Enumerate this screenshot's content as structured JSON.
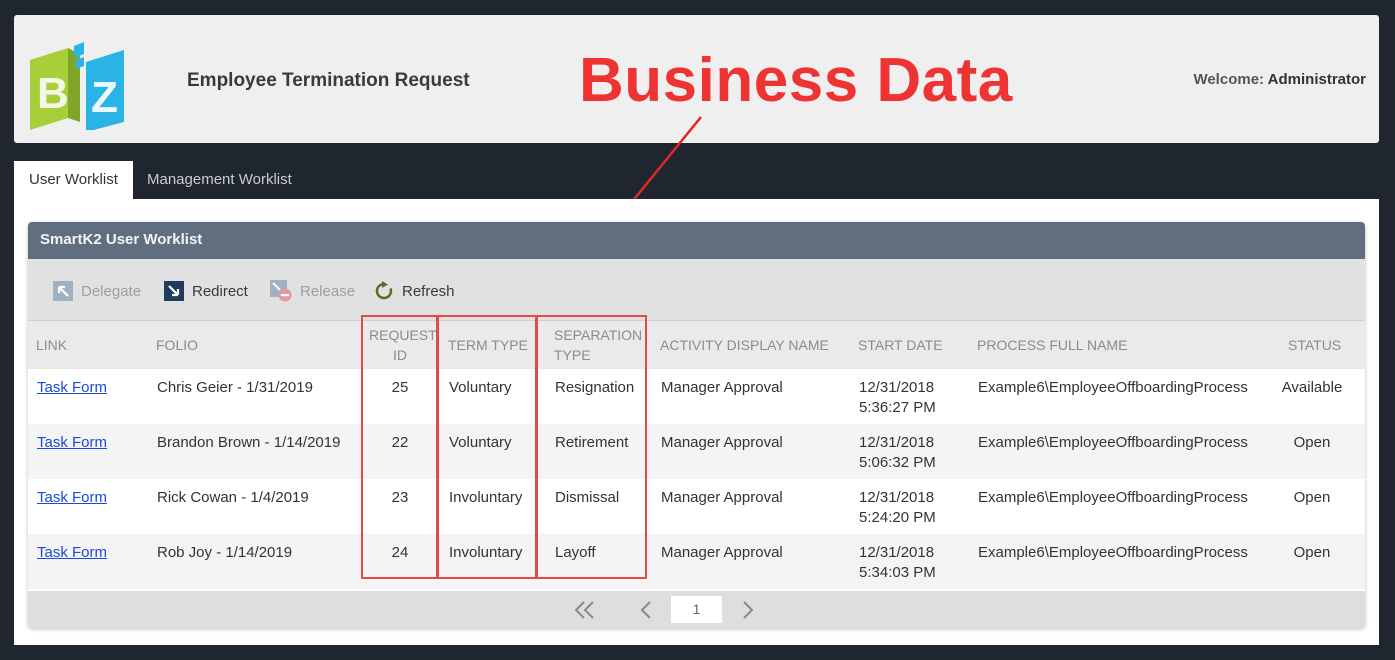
{
  "app": {
    "title": "Employee Termination Request",
    "welcome_label": "Welcome:",
    "user": "Administrator",
    "banner": "Business Data"
  },
  "tabs": [
    {
      "label": "User Worklist",
      "active": true
    },
    {
      "label": "Management Worklist",
      "active": false
    }
  ],
  "panel": {
    "title": "SmartK2 User Worklist"
  },
  "toolbar": {
    "delegate": "Delegate",
    "redirect": "Redirect",
    "release": "Release",
    "refresh": "Refresh"
  },
  "columns": {
    "link": "LINK",
    "folio": "FOLIO",
    "request_id_1": "REQUEST",
    "request_id_2": "ID",
    "term_type": "TERM TYPE",
    "separation_type_1": "SEPARATION",
    "separation_type_2": "TYPE",
    "activity": "ACTIVITY DISPLAY NAME",
    "start_date": "START DATE",
    "process": "PROCESS FULL NAME",
    "status": "STATUS"
  },
  "rows": [
    {
      "link": "Task Form",
      "folio": "Chris Geier - 1/31/2019",
      "request_id": "25",
      "term_type": "Voluntary",
      "separation_type": "Resignation",
      "activity": "Manager Approval",
      "date": "12/31/2018",
      "time": "5:36:27 PM",
      "process": "Example6\\EmployeeOffboardingProcess",
      "status": "Available"
    },
    {
      "link": "Task Form",
      "folio": "Brandon Brown - 1/14/2019",
      "request_id": "22",
      "term_type": "Voluntary",
      "separation_type": "Retirement",
      "activity": "Manager Approval",
      "date": "12/31/2018",
      "time": "5:06:32 PM",
      "process": "Example6\\EmployeeOffboardingProcess",
      "status": "Open"
    },
    {
      "link": "Task Form",
      "folio": "Rick Cowan - 1/4/2019",
      "request_id": "23",
      "term_type": "Involuntary",
      "separation_type": "Dismissal",
      "activity": "Manager Approval",
      "date": "12/31/2018",
      "time": "5:24:20 PM",
      "process": "Example6\\EmployeeOffboardingProcess",
      "status": "Open"
    },
    {
      "link": "Task Form",
      "folio": "Rob Joy - 1/14/2019",
      "request_id": "24",
      "term_type": "Involuntary",
      "separation_type": "Layoff",
      "activity": "Manager Approval",
      "date": "12/31/2018",
      "time": "5:34:03 PM",
      "process": "Example6\\EmployeeOffboardingProcess",
      "status": "Open"
    }
  ],
  "pager": {
    "current_page": "1"
  },
  "colors": {
    "accent_red": "#e24a4a",
    "panel_header": "#616e80",
    "link": "#1a4bd6",
    "background": "#1f2630"
  },
  "icons": {
    "delegate": "delegate-icon",
    "redirect": "redirect-icon",
    "release": "release-icon",
    "refresh": "refresh-icon",
    "first_page": "double-chevron-left-icon",
    "prev_page": "chevron-left-icon",
    "next_page": "chevron-right-icon",
    "logo": "biz-logo"
  }
}
